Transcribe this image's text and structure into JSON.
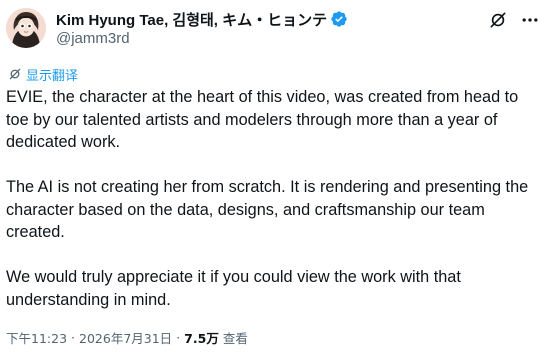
{
  "author": {
    "display_name": "Kim Hyung Tae, 김형태, キム・ヒョンテ",
    "handle": "@jamm3rd",
    "verified": true,
    "avatar_icon": "avatar-portrait"
  },
  "header_actions": {
    "grok_icon": "grok-icon",
    "more_icon": "more-icon"
  },
  "translate": {
    "label": "显示翻译",
    "icon": "translate-icon"
  },
  "tweet": {
    "paragraphs": [
      "EVIE, the character at the heart of this video, was created from head to toe by our talented artists and modelers through more than a year of dedicated work.",
      "The AI is not creating her from scratch. It is rendering and presenting the character based on the data, designs, and craftsmanship our team created.",
      "We would truly appreciate it if you could view the work with that understanding in mind."
    ]
  },
  "meta": {
    "time": "下午11:23",
    "date": "2026年7月31日",
    "separator": "·",
    "views_count": "7.5万",
    "views_label": "查看"
  },
  "colors": {
    "text": "#0f1419",
    "secondary": "#536471",
    "accent": "#1d9bf0"
  }
}
